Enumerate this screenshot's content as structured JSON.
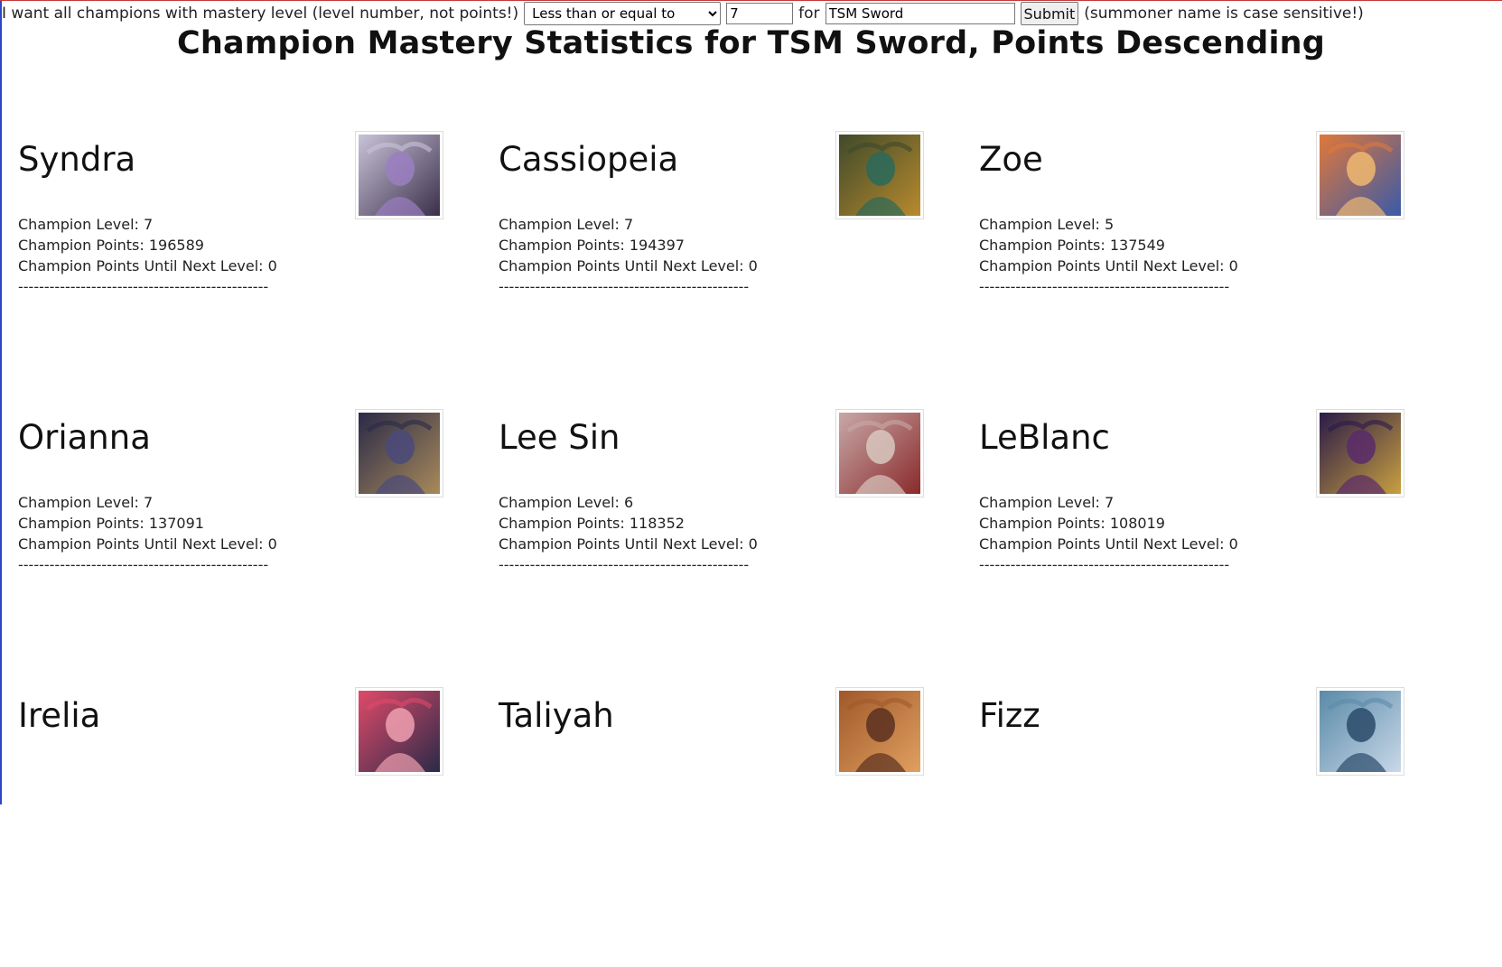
{
  "form": {
    "prefix_text": "I want all champions with mastery level (level number, not points!)",
    "comparison_selected": "Less than or equal to",
    "level_value": "7",
    "for_text": "for",
    "summoner_value": "TSM Sword",
    "submit_label": "Submit",
    "note_text": "(summoner name is case sensitive!)"
  },
  "title": "Champion Mastery Statistics for TSM Sword, Points Descending",
  "labels": {
    "level": "Champion Level: ",
    "points": "Champion Points: ",
    "until_next": "Champion Points Until Next Level: ",
    "divider": "------------------------------------------------"
  },
  "champions": [
    {
      "name": "Syndra",
      "level": "7",
      "points": "196589",
      "until_next": "0",
      "colors": [
        "#c9c3d8",
        "#3a2f4a",
        "#9b7fc2"
      ]
    },
    {
      "name": "Cassiopeia",
      "level": "7",
      "points": "194397",
      "until_next": "0",
      "colors": [
        "#3f4a2a",
        "#b88a2e",
        "#2a6a5a"
      ]
    },
    {
      "name": "Zoe",
      "level": "5",
      "points": "137549",
      "until_next": "0",
      "colors": [
        "#e0783a",
        "#3a5aa8",
        "#f0b870"
      ]
    },
    {
      "name": "Orianna",
      "level": "7",
      "points": "137091",
      "until_next": "0",
      "colors": [
        "#2a2a48",
        "#a88a5a",
        "#4a4a7a"
      ]
    },
    {
      "name": "Lee Sin",
      "level": "6",
      "points": "118352",
      "until_next": "0",
      "colors": [
        "#c8a8a8",
        "#8a2a2a",
        "#d8c8c0"
      ]
    },
    {
      "name": "LeBlanc",
      "level": "7",
      "points": "108019",
      "until_next": "0",
      "colors": [
        "#2a1a48",
        "#c8a040",
        "#5a2a6a"
      ]
    },
    {
      "name": "Irelia",
      "level": "",
      "points": "",
      "until_next": "",
      "colors": [
        "#e04a6a",
        "#2a2a48",
        "#f0a0b0"
      ]
    },
    {
      "name": "Taliyah",
      "level": "",
      "points": "",
      "until_next": "",
      "colors": [
        "#a0582a",
        "#e0a060",
        "#5a3020"
      ]
    },
    {
      "name": "Fizz",
      "level": "",
      "points": "",
      "until_next": "",
      "colors": [
        "#5a8aa8",
        "#c8d8e8",
        "#2a4a6a"
      ]
    }
  ]
}
